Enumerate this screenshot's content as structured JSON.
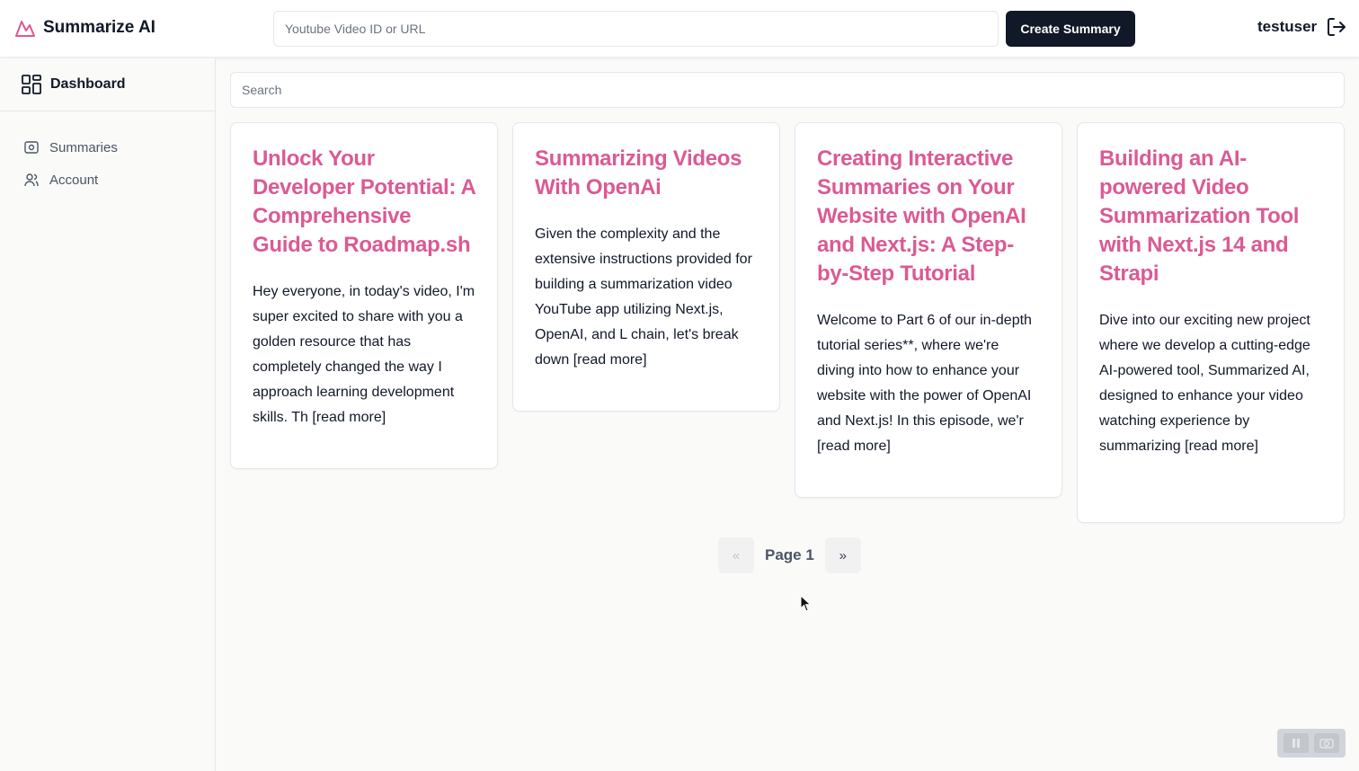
{
  "header": {
    "brand": "Summarize AI",
    "url_placeholder": "Youtube Video ID or URL",
    "create_label": "Create Summary",
    "username": "testuser"
  },
  "sidebar": {
    "dashboard_label": "Dashboard",
    "items": [
      {
        "label": "Summaries",
        "icon": "summaries-icon"
      },
      {
        "label": "Account",
        "icon": "users-icon"
      }
    ]
  },
  "main": {
    "search_placeholder": "Search",
    "cards": [
      {
        "title": "Unlock Your Developer Potential: A Comprehensive Guide to Roadmap.sh",
        "excerpt": "Hey everyone, in today's video, I'm super excited to share with you a golden resource that has completely changed the way I approach learning development skills. Th [read more]"
      },
      {
        "title": "Summarizing Videos With OpenAi",
        "excerpt": "Given the complexity and the extensive instructions provided for building a summarization video YouTube app utilizing Next.js, OpenAI, and L chain, let's break down [read more]"
      },
      {
        "title": "Creating Interactive Summaries on Your Website with OpenAI and Next.js: A Step-by-Step Tutorial",
        "excerpt": "Welcome to Part 6 of our in-depth tutorial series**, where we're diving into how to enhance your website with the power of OpenAI and Next.js! In this episode, we'r [read more]"
      },
      {
        "title": "Building an AI-powered Video Summarization Tool with Next.js 14 and Strapi",
        "excerpt": "Dive into our exciting new project where we develop a cutting-edge AI-powered tool, Summarized AI, designed to enhance your video watching experience by summarizing [read more]"
      }
    ],
    "pagination": {
      "prev": "«",
      "label": "Page 1",
      "next": "»"
    }
  },
  "colors": {
    "accent": "#db5a94",
    "primary_button": "#111827"
  }
}
